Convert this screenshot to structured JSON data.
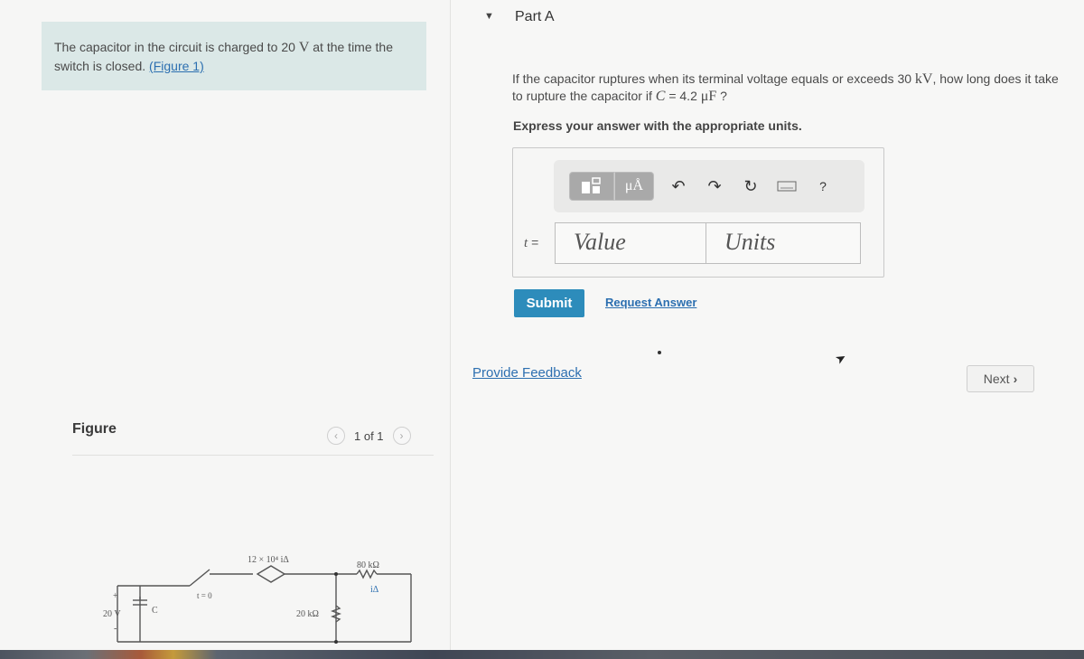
{
  "problem": {
    "text_pre": "The capacitor in the circuit is charged to 20 ",
    "voltage_unit": "V",
    "text_post": " at the time the switch is closed. ",
    "figure_link": "(Figure 1)"
  },
  "figure": {
    "header": "Figure",
    "pager": "1 of 1",
    "prev_icon": "chevron-left-icon",
    "next_icon": "chevron-right-icon",
    "circuit_labels": {
      "source": "20 V",
      "capacitor": "C",
      "plus": "+",
      "minus": "-",
      "switch": "t = 0",
      "dependent_source": "12 × 10⁴ iΔ",
      "resistor_top": "80 kΩ",
      "current": "iΔ",
      "resistor_bottom": "20 kΩ"
    }
  },
  "part": {
    "caret_icon": "caret-down-icon",
    "title": "Part A"
  },
  "question": {
    "line1": "If the capacitor ruptures when its terminal voltage equals or exceeds 30 ",
    "kv": "kV",
    "line2": ", how long does it take to rupture the capacitor if ",
    "c_sym": "C",
    "eq": " = 4.2 ",
    "uf": "μF",
    "end": " ?",
    "instruction": "Express your answer with the appropriate units."
  },
  "answer": {
    "toolbar": {
      "units_label": "μÅ",
      "icons": [
        "templates-icon",
        "units-icon",
        "undo-icon",
        "redo-icon",
        "reset-icon",
        "keyboard-icon",
        "help-icon"
      ],
      "help_label": "?"
    },
    "variable": "t",
    "equals": "=",
    "value_placeholder": "Value",
    "units_placeholder": "Units"
  },
  "actions": {
    "submit": "Submit",
    "request_answer": "Request Answer",
    "provide_feedback": "Provide Feedback",
    "next": "Next",
    "next_icon": "chevron-right-icon"
  }
}
